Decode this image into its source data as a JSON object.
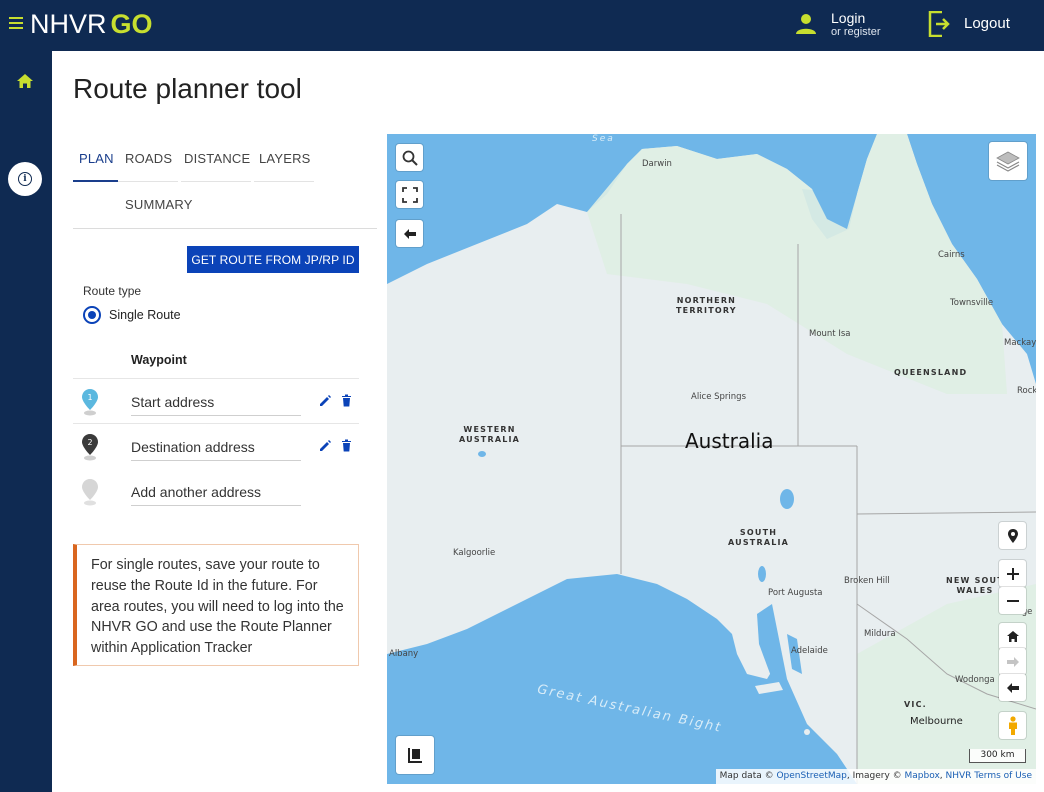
{
  "header": {
    "brand_nhvr": "NHVR",
    "brand_go": "GO",
    "login": "Login",
    "login_sub": "or register",
    "logout": "Logout"
  },
  "page": {
    "title": "Route planner tool"
  },
  "tabs": [
    {
      "label": "PLAN"
    },
    {
      "label": "ROADS"
    },
    {
      "label": "DISTANCE"
    },
    {
      "label": "LAYERS"
    },
    {
      "label": "SUMMARY"
    }
  ],
  "actions": {
    "get_route": "GET ROUTE FROM JP/RP ID"
  },
  "route_type": {
    "label": "Route type",
    "option": "Single Route"
  },
  "waypoints": {
    "heading": "Waypoint",
    "items": [
      {
        "number": "1",
        "text": "Start address"
      },
      {
        "number": "2",
        "text": "Destination address"
      },
      {
        "number": "",
        "text": "Add another address"
      }
    ]
  },
  "notice": "For single routes, save your route to reuse the Route Id in the future. For area routes, you will need to log into the NHVR GO and use the Route Planner within Application Tracker",
  "map": {
    "country": "Australia",
    "sea_label": "Great Australian Bight",
    "sea_top": "Sea",
    "states": {
      "nt": [
        "NORTHERN",
        "TERRITORY"
      ],
      "wa": [
        "WESTERN",
        "AUSTRALIA"
      ],
      "sa": [
        "SOUTH",
        "AUSTRALIA"
      ],
      "qld": "QUEENSLAND",
      "nsw": [
        "NEW SOUT",
        "WALES"
      ],
      "vic": "VIC."
    },
    "cities": {
      "darwin": "Darwin",
      "cairns": "Cairns",
      "townsville": "Townsville",
      "mount_isa": "Mount Isa",
      "mackay": "Mackay",
      "rock": "Rock",
      "alice_springs": "Alice Springs",
      "kalgoorlie": "Kalgoorlie",
      "broken_hill": "Broken Hill",
      "port_augusta": "Port Augusta",
      "adelaide": "Adelaide",
      "mildura": "Mildura",
      "wodonga": "Wodonga",
      "melbourne": "Melbourne",
      "albany": "Albany",
      "orange": "Orange"
    },
    "scale": "300 km",
    "attribution_prefix": "Map data © ",
    "attribution_osm": "OpenStreetMap",
    "attribution_mid": ", Imagery © ",
    "attribution_mapbox": "Mapbox",
    "attribution_sep": ", ",
    "attribution_terms": "NHVR Terms of Use"
  },
  "colors": {
    "navy": "#0f2a52",
    "lime": "#c7de2f",
    "primary_blue": "#0b43b8",
    "water": "#6fb6e8",
    "land": "#e8eef0",
    "notice_border": "#d9661f"
  }
}
